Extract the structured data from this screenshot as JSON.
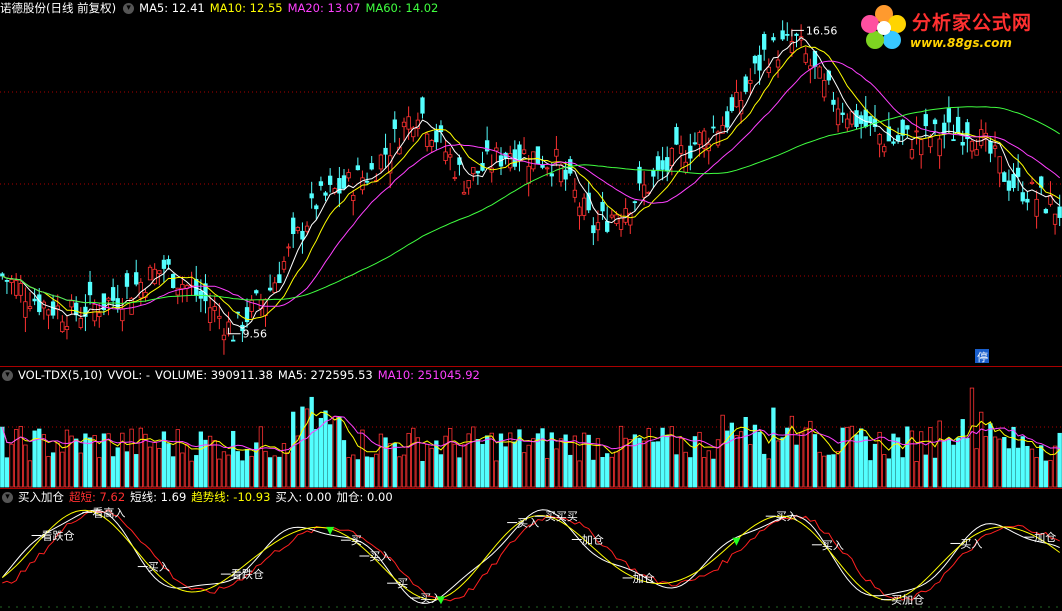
{
  "price": {
    "title": "诺德股份(日线 前复权)",
    "ma_labels": [
      {
        "text": "MA5: 12.41",
        "color": "#ffffff"
      },
      {
        "text": "MA10: 12.55",
        "color": "#ffff00"
      },
      {
        "text": "MA20: 13.07",
        "color": "#ff40ff"
      },
      {
        "text": "MA60: 14.02",
        "color": "#40ff40"
      }
    ],
    "high_label": "16.56",
    "low_label": "9.56",
    "limit_tag": "停",
    "high_value": 16.56,
    "low_value": 9.56
  },
  "logo": {
    "title": "分析家公式网",
    "url": "www.88gs.com"
  },
  "volume": {
    "title": "VOL-TDX(5,10)",
    "labels": [
      {
        "text": "VVOL: -",
        "color": "#ffffff"
      },
      {
        "text": "VOLUME: 390911.38",
        "color": "#ffffff"
      },
      {
        "text": "MA5: 272595.53",
        "color": "#ffffff"
      },
      {
        "text": "MA10: 251045.92",
        "color": "#ff40ff"
      }
    ]
  },
  "indicator": {
    "title": "买入加仓",
    "labels": [
      {
        "text": "超短: 7.62",
        "color": "#ff3030"
      },
      {
        "text": "短线: 1.69",
        "color": "#ffffff"
      },
      {
        "text": "趋势线: -10.93",
        "color": "#ffff00"
      },
      {
        "text": "买入: 0.00",
        "color": "#ffffff"
      },
      {
        "text": "加仓: 0.00",
        "color": "#ffffff"
      }
    ],
    "signals": [
      {
        "text": "看跌仓",
        "day": 9
      },
      {
        "text": "看高入",
        "day": 20
      },
      {
        "text": "买入",
        "day": 32
      },
      {
        "text": "看跌仓",
        "day": 50
      },
      {
        "text": "买",
        "day": 76
      },
      {
        "text": "买入",
        "day": 80
      },
      {
        "text": "买",
        "day": 86
      },
      {
        "text": "买入",
        "day": 91
      },
      {
        "text": "买入",
        "day": 112
      },
      {
        "text": "买买买",
        "day": 118
      },
      {
        "text": "加仓",
        "day": 126
      },
      {
        "text": "加仓",
        "day": 137
      },
      {
        "text": "买入",
        "day": 168
      },
      {
        "text": "买入",
        "day": 178
      },
      {
        "text": "买加仓",
        "day": 193
      },
      {
        "text": "买入",
        "day": 208
      },
      {
        "text": "加仓",
        "day": 224
      }
    ],
    "arrows": [
      {
        "day": 71
      },
      {
        "day": 95
      },
      {
        "day": 159
      }
    ]
  },
  "colors": {
    "up": "#ff3232",
    "down": "#54ffff",
    "ma5": "#ffffff",
    "ma10": "#ffff00",
    "ma20": "#ff40ff",
    "ma60": "#40ff40",
    "grid": "#aa0000",
    "arrow": "#22ff22"
  }
}
